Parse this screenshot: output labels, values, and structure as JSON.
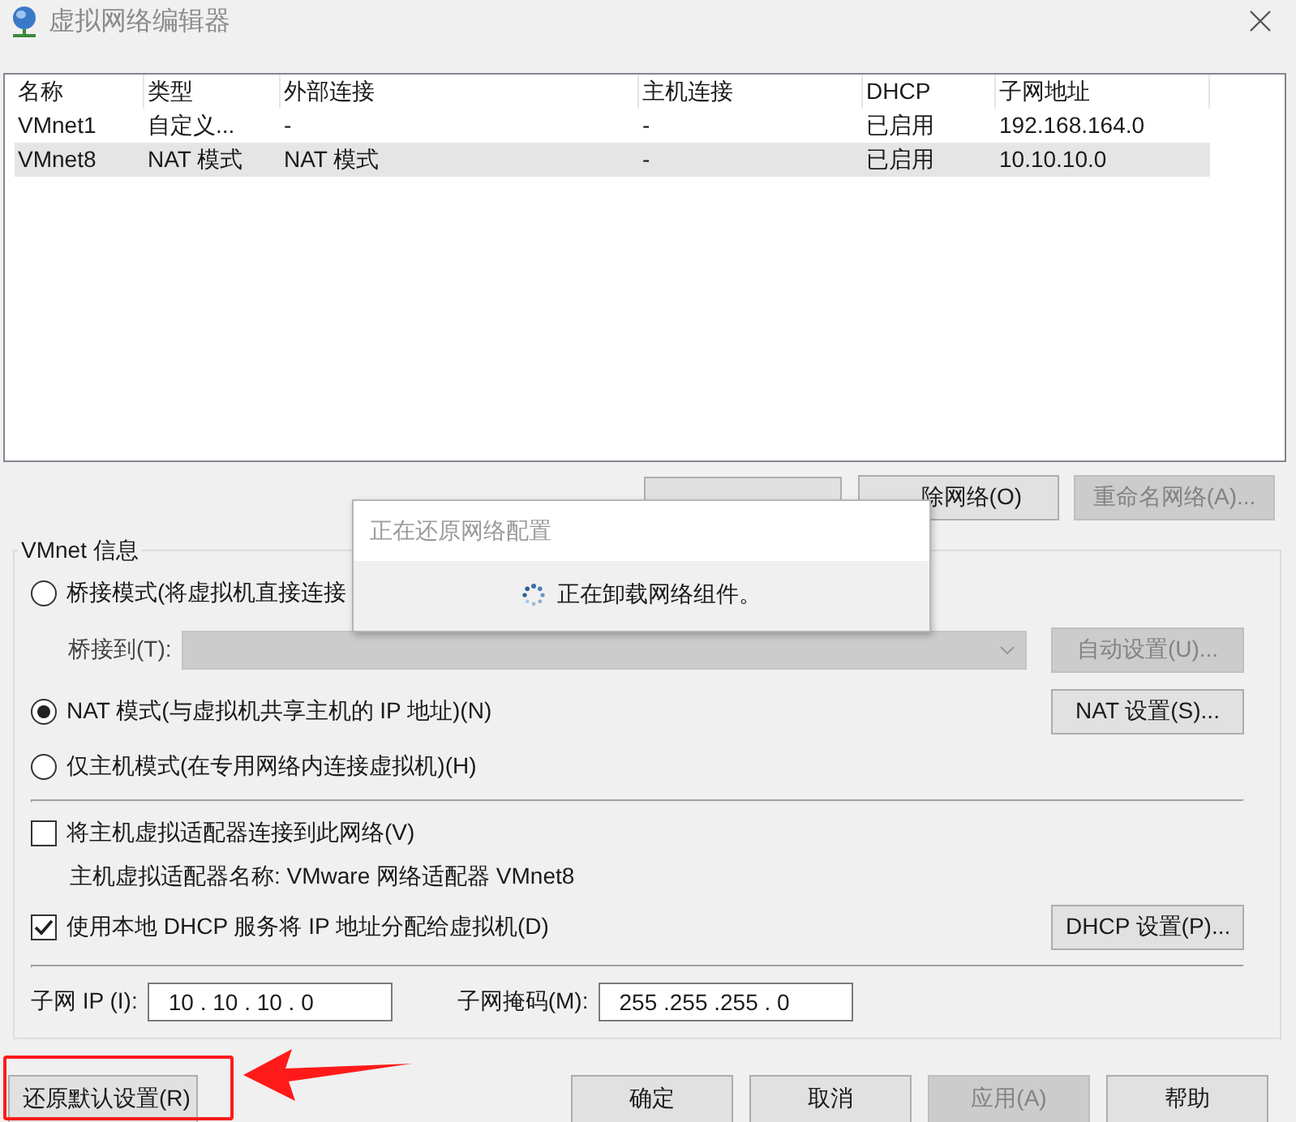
{
  "window": {
    "title": "虚拟网络编辑器"
  },
  "table": {
    "columns": [
      "名称",
      "类型",
      "外部连接",
      "主机连接",
      "DHCP",
      "子网地址"
    ],
    "rows": [
      {
        "cells": [
          "VMnet1",
          "自定义...",
          "-",
          "-",
          "已启用",
          "192.168.164.0"
        ],
        "selected": false
      },
      {
        "cells": [
          "VMnet8",
          "NAT 模式",
          "NAT 模式",
          "-",
          "已启用",
          "10.10.10.0"
        ],
        "selected": true
      }
    ]
  },
  "list_buttons": [
    {
      "label": "除网络(O)",
      "disabled": false
    },
    {
      "label": "重命名网络(A)...",
      "disabled": true
    }
  ],
  "vmnet_info": {
    "title": "VMnet 信息",
    "modes": [
      {
        "label": "桥接模式(将虚拟机直接连接",
        "selected": false
      },
      {
        "label": "NAT 模式(与虚拟机共享主机的 IP 地址)(N)",
        "selected": true
      },
      {
        "label": "仅主机模式(在专用网络内连接虚拟机)(H)",
        "selected": false
      }
    ],
    "bridge_to": {
      "label": "桥接到(T):",
      "disabled": true
    },
    "auto_button": {
      "label": "自动设置(U)...",
      "disabled": true
    },
    "nat_button": {
      "label": "NAT 设置(S)...",
      "disabled": false
    },
    "host_adapter": {
      "label": "将主机虚拟适配器连接到此网络(V)",
      "checked": false
    },
    "adapter_name": "主机虚拟适配器名称: VMware 网络适配器 VMnet8",
    "dhcp": {
      "label": "使用本地 DHCP 服务将 IP 地址分配给虚拟机(D)",
      "checked": true
    },
    "dhcp_button": {
      "label": "DHCP 设置(P)...",
      "disabled": false
    },
    "subnet_ip": {
      "label": "子网 IP (I):",
      "value": "10 . 10 . 10 . 0"
    },
    "subnet_mask": {
      "label": "子网掩码(M):",
      "value": "255 .255 .255 . 0"
    }
  },
  "reset_button": {
    "label": "还原默认设置(R)",
    "disabled": false
  },
  "footer_buttons": [
    {
      "label": "确定",
      "disabled": false
    },
    {
      "label": "取消",
      "disabled": false
    },
    {
      "label": "应用(A)",
      "disabled": true
    },
    {
      "label": "帮助",
      "disabled": false
    }
  ],
  "progress_dialog": {
    "title": "正在还原网络配置",
    "message": "正在卸载网络组件。"
  }
}
